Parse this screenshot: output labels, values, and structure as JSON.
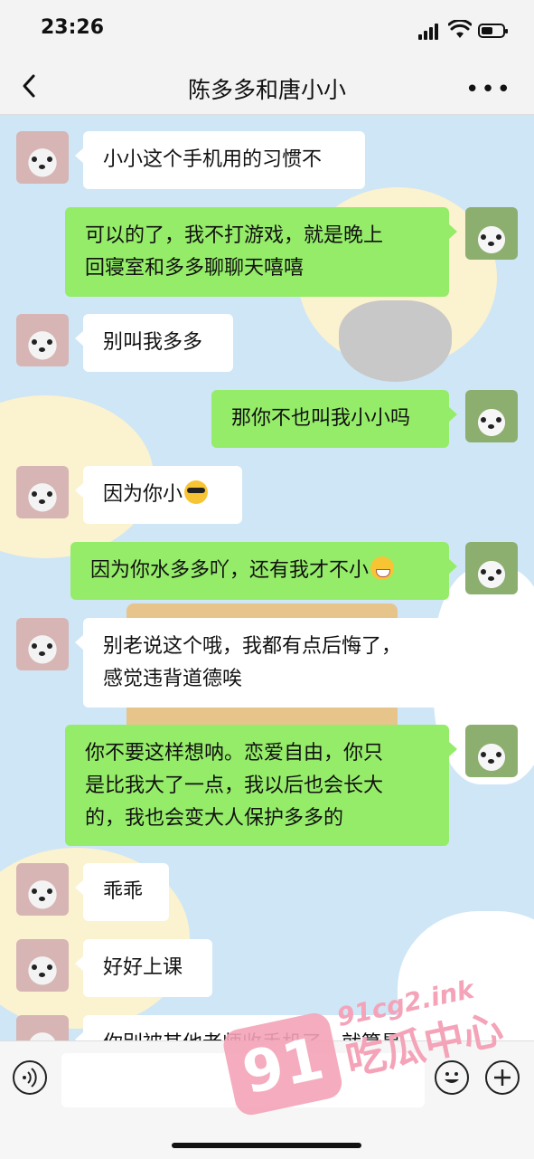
{
  "status_bar": {
    "time": "23:26"
  },
  "nav": {
    "title": "陈多多和唐小小",
    "more": "•••"
  },
  "messages": [
    {
      "side": "left",
      "text": "小小这个手机用的习惯不"
    },
    {
      "side": "right",
      "text": "可以的了，我不打游戏，就是晚上\n回寝室和多多聊聊天嘻嘻"
    },
    {
      "side": "left",
      "text": "别叫我多多"
    },
    {
      "side": "right",
      "text": "那你不也叫我小小吗"
    },
    {
      "side": "left",
      "text": "因为你小",
      "emoji": "sunglasses-emoji"
    },
    {
      "side": "right",
      "text": "因为你水多多吖，还有我才不小",
      "emoji": "laughing-emoji"
    },
    {
      "side": "left",
      "text": "别老说这个哦，我都有点后悔了，\n感觉违背道德唉"
    },
    {
      "side": "right",
      "text": "你不要这样想呐。恋爱自由，你只\n是比我大了一点，我以后也会长大\n的，我也会变大人保护多多的"
    },
    {
      "side": "left",
      "text": "乖乖"
    },
    {
      "side": "left",
      "text": "好好上课"
    },
    {
      "side": "left",
      "text": "你别被其他老师收手机了，就算是"
    }
  ],
  "watermark": {
    "number": "91",
    "domain": "91cg2.ink",
    "name": "吃瓜中心"
  },
  "colors": {
    "sent_bubble": "#95ec69",
    "received_bubble": "#ffffff",
    "chat_bg": "#cfe6f6"
  }
}
